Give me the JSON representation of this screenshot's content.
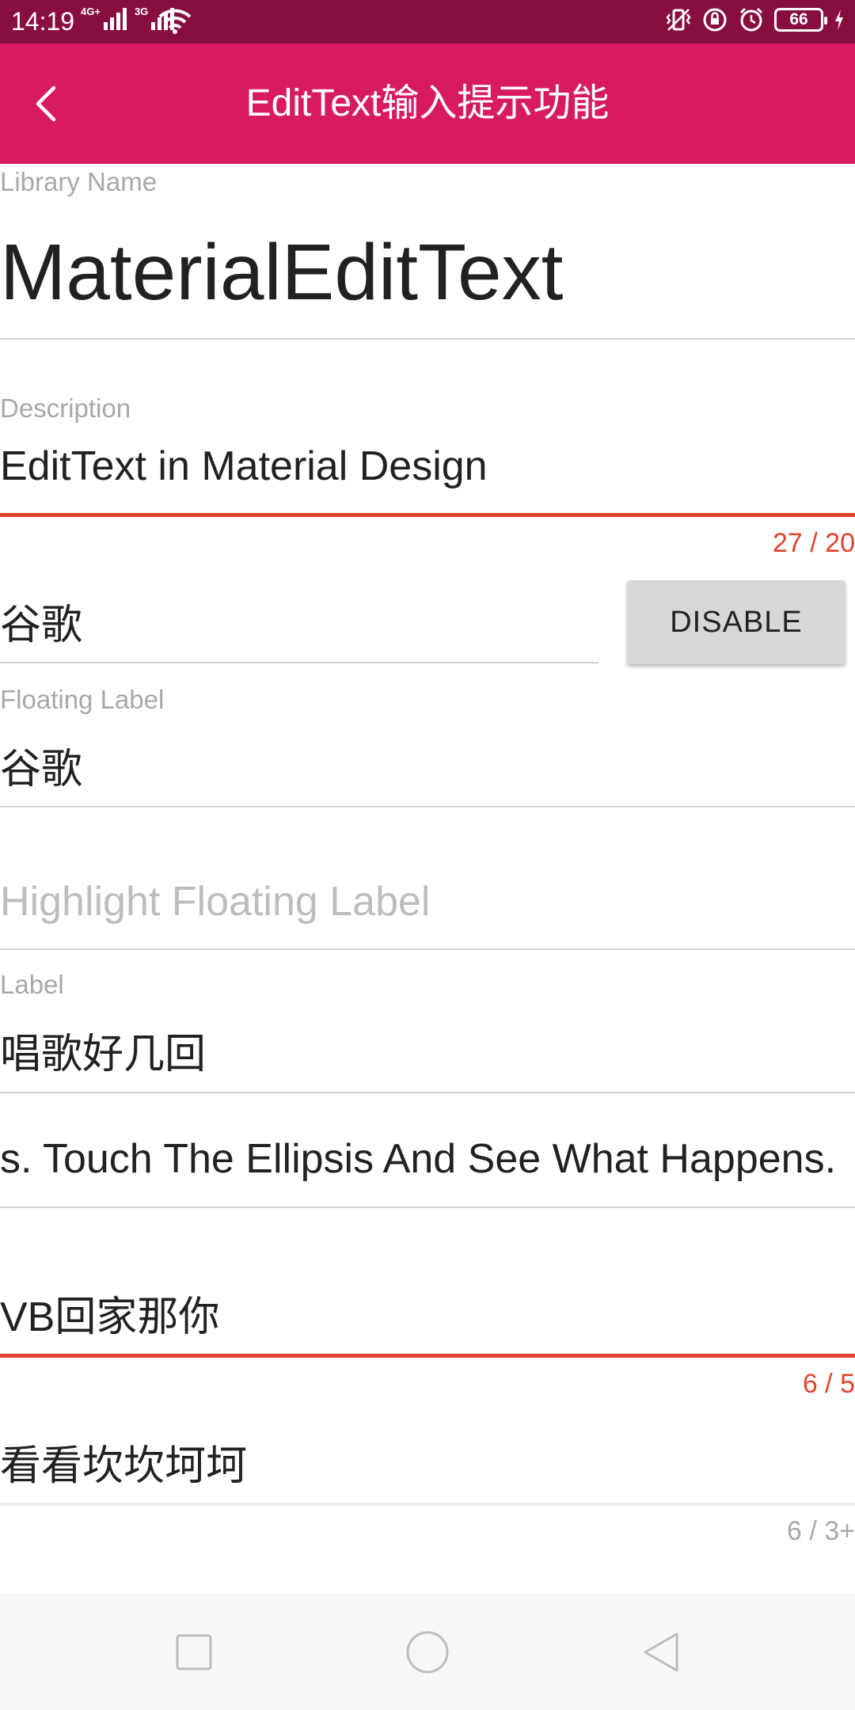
{
  "status_bar": {
    "time": "14:19",
    "net1": "4G+",
    "net2": "3G",
    "battery": "66",
    "icons": [
      "signal-icon",
      "wifi-icon",
      "vibrate-icon",
      "rotation-lock-icon",
      "alarm-icon",
      "battery-icon",
      "charging-icon"
    ]
  },
  "app_bar": {
    "title": "EditText输入提示功能",
    "back_icon": "back-arrow-icon",
    "color": "#d81b60"
  },
  "fields": {
    "library": {
      "label": "Library Name",
      "value": "MaterialEditText"
    },
    "description": {
      "label": "Description",
      "value": "EditText in Material Design",
      "counter": "27 / 20"
    },
    "disable_field": {
      "value": "谷歌",
      "button": "DISABLE"
    },
    "floating": {
      "label": "Floating Label",
      "value": "谷歌"
    },
    "highlight": {
      "placeholder": "Highlight Floating Label"
    },
    "label_field": {
      "label": "Label",
      "value": "唱歌好几回"
    },
    "ellipsis": {
      "value": "s. Touch The Ellipsis And See What Happens."
    },
    "vb_field": {
      "value": "VB回家那你",
      "counter": "6 / 5"
    },
    "kan_field": {
      "value": "看看坎坎坷坷",
      "counter": "6 / 3+"
    }
  },
  "nav_bar": {
    "icons": [
      "recent-apps-icon",
      "home-icon",
      "back-icon"
    ]
  },
  "colors": {
    "status_bar": "#880e3f",
    "error": "#e0432b",
    "divider": "#d2d2d2",
    "hint": "#bdbdbd"
  }
}
